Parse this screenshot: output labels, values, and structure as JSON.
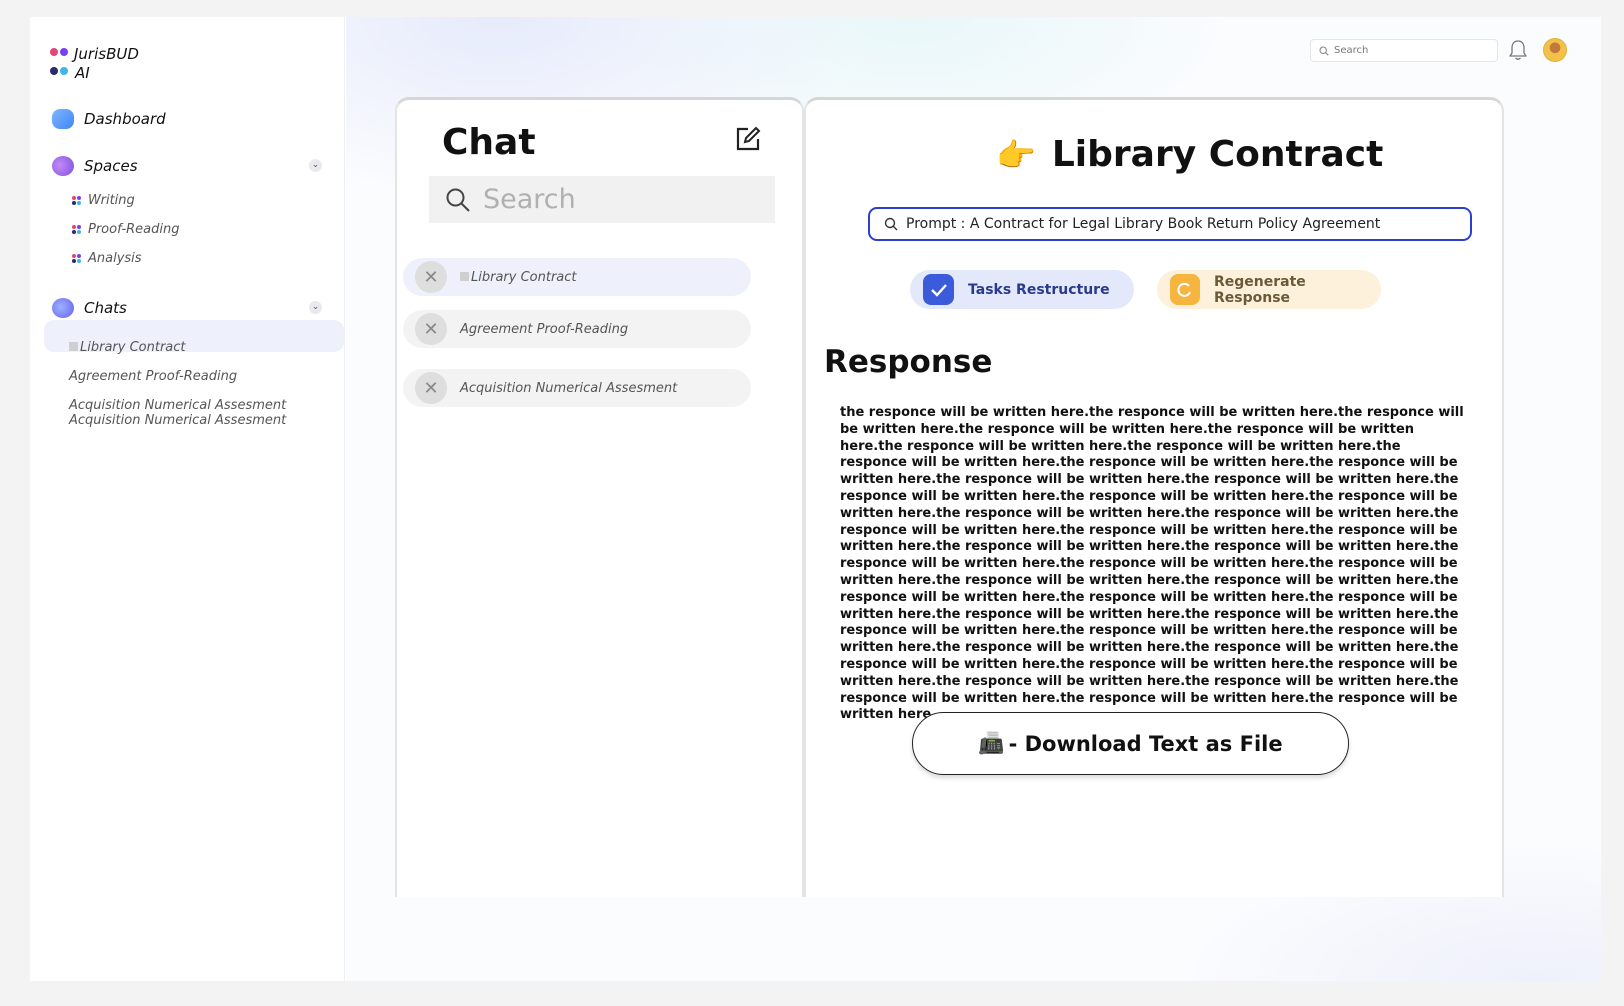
{
  "app": {
    "logo_line1": "JurisBUD",
    "logo_line2": "AI"
  },
  "sidebar": {
    "dashboard_label": "Dashboard",
    "spaces_label": "Spaces",
    "spaces_items": [
      "Writing",
      "Proof-Reading",
      "Analysis"
    ],
    "chats_label": "Chats",
    "chats_items": [
      "Library Contract",
      "Agreement Proof-Reading",
      "Acquisition Numerical Assesment",
      "Acquisition Numerical Assesment"
    ]
  },
  "topbar": {
    "search_placeholder": "Search"
  },
  "chat_panel": {
    "title": "Chat",
    "search_placeholder": "Search",
    "items": [
      "Library Contract",
      "Agreement Proof-Reading",
      "Acquisition Numerical Assesment"
    ]
  },
  "response_panel": {
    "title_emoji": "👉",
    "title": "Library Contract",
    "prompt": "Prompt : A Contract for Legal Library Book Return Policy Agreement",
    "tasks_button": "Tasks Restructure",
    "regenerate_button": "Regenerate Response",
    "heading": "Response",
    "body": "the responce will be written here.the responce will be written here.the responce will be written here.the responce will be written here.the responce will be written here.the responce will be written here.the responce will be written here.the responce will be written here.the responce will be written here.the responce will be written here.the responce will be written here.the responce will be written here.the responce will be written here.the responce will be written here.the responce will be written here.the responce will be written here.the responce will be written here.the responce will be written here.the responce will be written here.the responce will be written here.the responce will be written here.the responce will be written here.the responce will be written here.the responce will be written here.the responce will be written here.the responce will be written here.the responce will be written here.the responce will be written here.the responce will be written here.the responce will be written here.the responce will be written here.the responce will be written here.the responce will be written here.the responce will be written here.the responce will be written here.the responce will be written here.the responce will be written here.the responce will be written here.the responce will be written here.the responce will be written here.the responce will be written here.the responce will be written here.the responce will be written here.the responce will be written here.the responce will be written here........",
    "download_emoji": "📠",
    "download_label": "- Download Text as File"
  },
  "colors": {
    "accent": "#2d3fd0",
    "tasks_bg": "#e3e9fb",
    "tasks_icon": "#3b5bdb",
    "regen_bg": "#fdf1dc",
    "regen_icon": "#f5b53f",
    "active_chat_bg": "#eef0fb"
  },
  "icons": [
    "logo-icon",
    "dashboard-icon",
    "spaces-icon",
    "chats-icon",
    "search-icon",
    "bell-icon",
    "edit-icon",
    "close-icon",
    "check-icon",
    "refresh-icon"
  ]
}
